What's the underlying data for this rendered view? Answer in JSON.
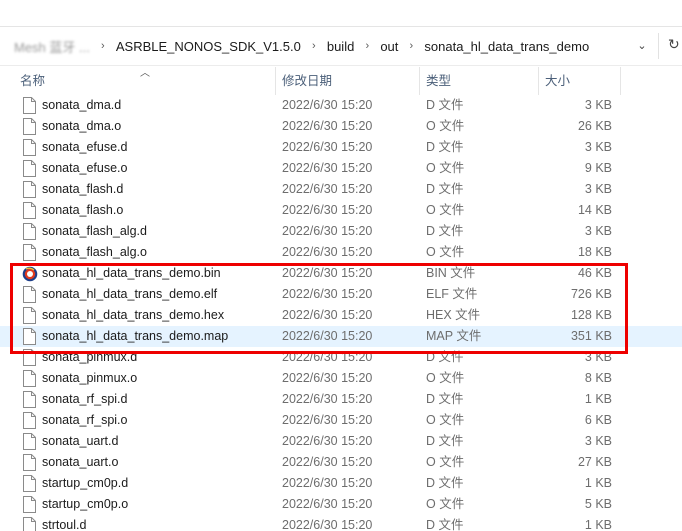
{
  "breadcrumb": {
    "faded_segment": "Mesh 蓝牙 ...",
    "segments": [
      "ASRBLE_NONOS_SDK_V1.5.0",
      "build",
      "out",
      "sonata_hl_data_trans_demo"
    ]
  },
  "columns": {
    "name": "名称",
    "date": "修改日期",
    "type": "类型",
    "size": "大小"
  },
  "highlight_color": "#ee0000",
  "files": [
    {
      "name": "sonata_dma.d",
      "date": "2022/6/30 15:20",
      "type": "D 文件",
      "size": "3 KB",
      "icon": "file-icon"
    },
    {
      "name": "sonata_dma.o",
      "date": "2022/6/30 15:20",
      "type": "O 文件",
      "size": "26 KB",
      "icon": "file-icon"
    },
    {
      "name": "sonata_efuse.d",
      "date": "2022/6/30 15:20",
      "type": "D 文件",
      "size": "3 KB",
      "icon": "file-icon"
    },
    {
      "name": "sonata_efuse.o",
      "date": "2022/6/30 15:20",
      "type": "O 文件",
      "size": "9 KB",
      "icon": "file-icon"
    },
    {
      "name": "sonata_flash.d",
      "date": "2022/6/30 15:20",
      "type": "D 文件",
      "size": "3 KB",
      "icon": "file-icon"
    },
    {
      "name": "sonata_flash.o",
      "date": "2022/6/30 15:20",
      "type": "O 文件",
      "size": "14 KB",
      "icon": "file-icon"
    },
    {
      "name": "sonata_flash_alg.d",
      "date": "2022/6/30 15:20",
      "type": "D 文件",
      "size": "3 KB",
      "icon": "file-icon"
    },
    {
      "name": "sonata_flash_alg.o",
      "date": "2022/6/30 15:20",
      "type": "O 文件",
      "size": "18 KB",
      "icon": "file-icon"
    },
    {
      "name": "sonata_hl_data_trans_demo.bin",
      "date": "2022/6/30 15:20",
      "type": "BIN 文件",
      "size": "46 KB",
      "icon": "bin-file-icon"
    },
    {
      "name": "sonata_hl_data_trans_demo.elf",
      "date": "2022/6/30 15:20",
      "type": "ELF 文件",
      "size": "726 KB",
      "icon": "file-icon"
    },
    {
      "name": "sonata_hl_data_trans_demo.hex",
      "date": "2022/6/30 15:20",
      "type": "HEX 文件",
      "size": "128 KB",
      "icon": "file-icon"
    },
    {
      "name": "sonata_hl_data_trans_demo.map",
      "date": "2022/6/30 15:20",
      "type": "MAP 文件",
      "size": "351 KB",
      "icon": "file-icon",
      "hovered": true
    },
    {
      "name": "sonata_pinmux.d",
      "date": "2022/6/30 15:20",
      "type": "D 文件",
      "size": "3 KB",
      "icon": "file-icon"
    },
    {
      "name": "sonata_pinmux.o",
      "date": "2022/6/30 15:20",
      "type": "O 文件",
      "size": "8 KB",
      "icon": "file-icon"
    },
    {
      "name": "sonata_rf_spi.d",
      "date": "2022/6/30 15:20",
      "type": "D 文件",
      "size": "1 KB",
      "icon": "file-icon"
    },
    {
      "name": "sonata_rf_spi.o",
      "date": "2022/6/30 15:20",
      "type": "O 文件",
      "size": "6 KB",
      "icon": "file-icon"
    },
    {
      "name": "sonata_uart.d",
      "date": "2022/6/30 15:20",
      "type": "D 文件",
      "size": "3 KB",
      "icon": "file-icon"
    },
    {
      "name": "sonata_uart.o",
      "date": "2022/6/30 15:20",
      "type": "O 文件",
      "size": "27 KB",
      "icon": "file-icon"
    },
    {
      "name": "startup_cm0p.d",
      "date": "2022/6/30 15:20",
      "type": "D 文件",
      "size": "1 KB",
      "icon": "file-icon"
    },
    {
      "name": "startup_cm0p.o",
      "date": "2022/6/30 15:20",
      "type": "O 文件",
      "size": "5 KB",
      "icon": "file-icon"
    },
    {
      "name": "strtoul.d",
      "date": "2022/6/30 15:20",
      "type": "D 文件",
      "size": "1 KB",
      "icon": "file-icon"
    }
  ]
}
